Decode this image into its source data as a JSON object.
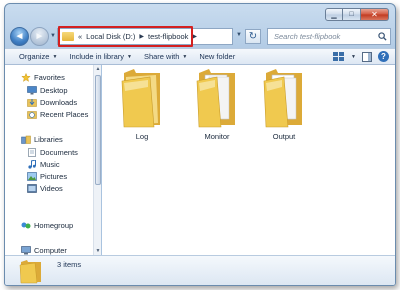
{
  "navigation": {
    "back_label": "",
    "forward_label": ""
  },
  "address": {
    "overflow": "«",
    "parts": [
      "Local Disk (D:)",
      "test-flipbook"
    ]
  },
  "search": {
    "placeholder": "Search test-flipbook"
  },
  "commands": {
    "organize": "Organize",
    "include_in_library": "Include in library",
    "share_with": "Share with",
    "new_folder": "New folder"
  },
  "nav_pane": {
    "favorites": "Favorites",
    "favorites_items": [
      "Desktop",
      "Downloads",
      "Recent Places"
    ],
    "libraries": "Libraries",
    "libraries_items": [
      "Documents",
      "Music",
      "Pictures",
      "Videos"
    ],
    "homegroup": "Homegroup",
    "computer": "Computer"
  },
  "content": {
    "folders": [
      "Log",
      "Monitor",
      "Output"
    ]
  },
  "details": {
    "item_count": "3 items"
  },
  "colors": {
    "highlight_border": "#d42020",
    "folder_yellow": "#f2cf63"
  }
}
